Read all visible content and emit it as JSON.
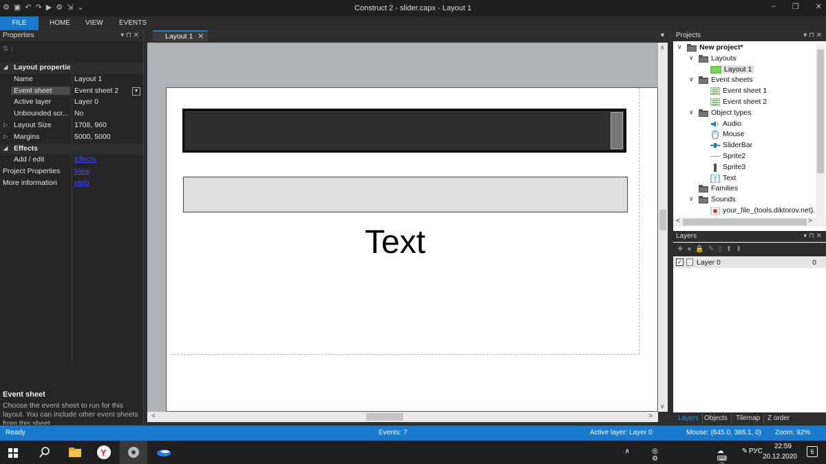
{
  "window": {
    "title": "Construct 2 - slider.capx - Layout 1",
    "minimize": "–",
    "restore": "❐",
    "close": "✕"
  },
  "ribbon": {
    "tabs": [
      "FILE",
      "HOME",
      "VIEW",
      "EVENTS"
    ]
  },
  "properties": {
    "header": "Properties",
    "rows": [
      {
        "key": "Layout properties",
        "value": "",
        "type": "section",
        "expander": "◢"
      },
      {
        "key": "Name",
        "value": "Layout 1"
      },
      {
        "key": "Event sheet",
        "value": "Event sheet 2",
        "selected": true
      },
      {
        "key": "Active layer",
        "value": "Layer 0"
      },
      {
        "key": "Unbounded scr...",
        "value": "No"
      },
      {
        "key": "Layout Size",
        "value": "1708, 960",
        "expander": "▷"
      },
      {
        "key": "Margins",
        "value": "5000, 5000",
        "expander": "▷"
      },
      {
        "key": "Effects",
        "value": "",
        "type": "section",
        "expander": "◢"
      },
      {
        "key": "Add / edit",
        "value": "Effects",
        "link": true
      },
      {
        "key": "Project Properties",
        "value": "View",
        "link": true,
        "top": true
      },
      {
        "key": "More information",
        "value": "Help",
        "link": true,
        "top": true
      }
    ],
    "desc_title": "Event sheet",
    "desc_text": "Choose the event sheet to run for this layout. You can include other event sheets from this sheet."
  },
  "document": {
    "tab_label": "Layout 1",
    "canvas_text": "Text"
  },
  "projects": {
    "header": "Projects",
    "items": [
      {
        "label": "New project*",
        "depth": 0,
        "arrow": "∨",
        "icon": "folder",
        "bold": true
      },
      {
        "label": "Layouts",
        "depth": 1,
        "arrow": "∨",
        "icon": "folder"
      },
      {
        "label": "Layout 1",
        "depth": 2,
        "icon": "layout",
        "selected": true
      },
      {
        "label": "Event sheets",
        "depth": 1,
        "arrow": "∨",
        "icon": "folder"
      },
      {
        "label": "Event sheet 1",
        "depth": 2,
        "icon": "sheet"
      },
      {
        "label": "Event sheet 2",
        "depth": 2,
        "icon": "sheet"
      },
      {
        "label": "Object types",
        "depth": 1,
        "arrow": "∨",
        "icon": "folder"
      },
      {
        "label": "Audio",
        "depth": 2,
        "icon": "audio"
      },
      {
        "label": "Mouse",
        "depth": 2,
        "icon": "mouse"
      },
      {
        "label": "SliderBar",
        "depth": 2,
        "icon": "slider"
      },
      {
        "label": "Sprite2",
        "depth": 2,
        "icon": "line"
      },
      {
        "label": "Sprite3",
        "depth": 2,
        "icon": "bar"
      },
      {
        "label": "Text",
        "depth": 2,
        "icon": "text"
      },
      {
        "label": "Families",
        "depth": 1,
        "icon": "folder"
      },
      {
        "label": "Sounds",
        "depth": 1,
        "arrow": "∨",
        "icon": "folder"
      },
      {
        "label": "your_file_(tools.diktorov.net).",
        "depth": 2,
        "icon": "sound"
      }
    ]
  },
  "layers": {
    "header": "Layers",
    "rows": [
      {
        "name": "Layer 0",
        "index": "0"
      }
    ],
    "tabs": [
      "Layers",
      "Objects",
      "Tilemap",
      "Z order"
    ]
  },
  "status": {
    "ready": "Ready",
    "events": "Events: 7",
    "active_layer": "Active layer: Layer 0",
    "mouse": "Mouse: (645.0, 386.1, 0)",
    "zoom": "Zoom: 92%"
  },
  "taskbar": {
    "lang": "РУС",
    "time": "22:59",
    "date": "20.12.2020",
    "notifications": "6"
  },
  "colors": {
    "accent": "#1c7acc",
    "panel": "#252526",
    "canvas": "#aeb1b6"
  }
}
